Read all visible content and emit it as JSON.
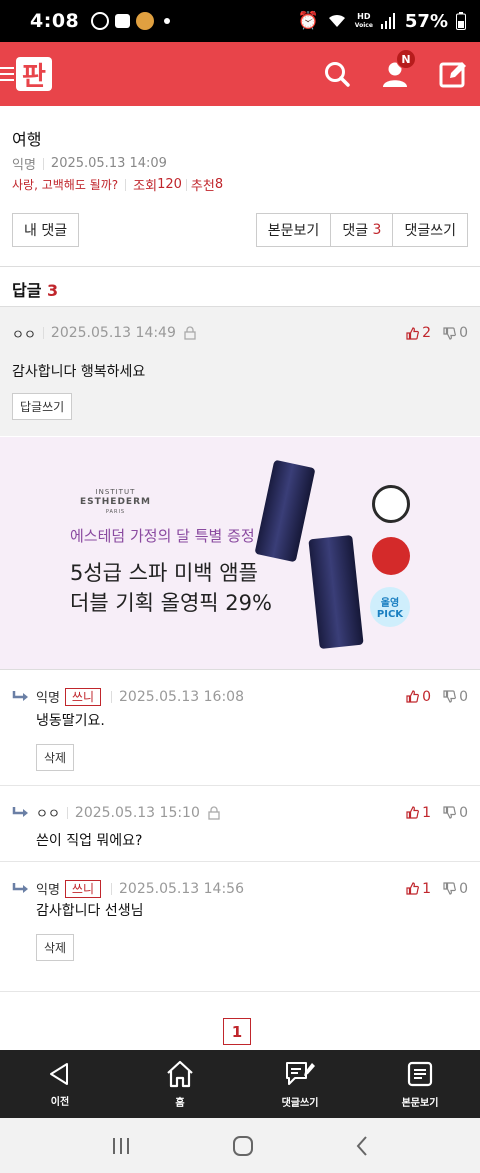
{
  "status_bar": {
    "time": "4:08",
    "battery": "57%",
    "network": "HD",
    "network_sub": "Voice"
  },
  "header": {
    "logo_text": "판",
    "notification_badge": "N"
  },
  "post": {
    "title": "여행",
    "author": "익명",
    "date": "2025.05.13 14:09",
    "category": "사랑, 고백해도 될까?",
    "views_label": "조회",
    "views": "120",
    "recommend_label": "추천",
    "recommend": "8"
  },
  "buttons": {
    "my_comments": "내 댓글",
    "view_post": "본문보기",
    "comments_label": "댓글",
    "comments_count": "3",
    "write_comment": "댓글쓰기"
  },
  "replies": {
    "label": "답글",
    "count": "3"
  },
  "main_comment": {
    "nick": "ㅇㅇ",
    "date": "2025.05.13 14:49",
    "up": "2",
    "down": "0",
    "body": "감사합니다 행복하세요",
    "reply_button": "답글쓰기"
  },
  "ad": {
    "brand_line1": "INSTITUT",
    "brand_line2": "ESTHEDERM",
    "brand_line3": "PARIS",
    "subtitle": "에스테덤 가정의 달 특별 증정",
    "line1": "5성급 스파 미백 앰플",
    "line2": "더블 기획 올영픽 29%",
    "badge_pick": "올영 PICK"
  },
  "sub_comments": [
    {
      "nick": "익명",
      "tag": "쓰니",
      "date": "2025.05.13 16:08",
      "up": "0",
      "down": "0",
      "body": "냉동딸기요.",
      "delete": "삭제"
    },
    {
      "nick": "ㅇㅇ",
      "date": "2025.05.13 15:10",
      "up": "1",
      "down": "0",
      "body": "쓴이 직업 뭐에요?"
    },
    {
      "nick": "익명",
      "tag": "쓰니",
      "date": "2025.05.13 14:56",
      "up": "1",
      "down": "0",
      "body": "감사합니다 선생님",
      "delete": "삭제"
    }
  ],
  "pagination": {
    "current": "1"
  },
  "bottom_nav": {
    "prev": "이전",
    "home": "홈",
    "write_comment": "댓글쓰기",
    "view_post": "본문보기"
  }
}
